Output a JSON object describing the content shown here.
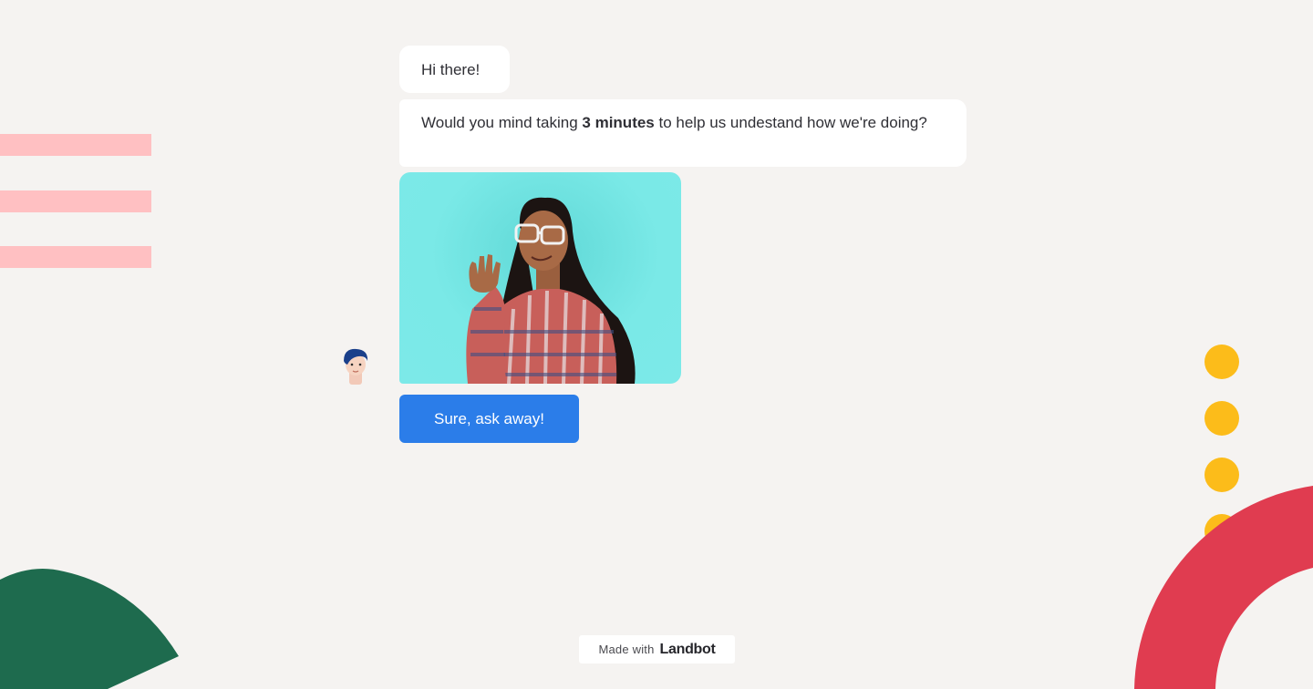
{
  "chat": {
    "messages": [
      {
        "text": "Hi there!"
      },
      {
        "before": "Would you mind taking ",
        "bold": "3 minutes",
        "after": " to help us undestand how we're doing?"
      }
    ],
    "reply_button": "Sure, ask away!"
  },
  "footer": {
    "made_with": "Made with",
    "brand": "Landbot"
  },
  "colors": {
    "background": "#f5f3f1",
    "button_blue": "#2b7de9",
    "stripe_pink": "#ffc0c2",
    "dot_yellow": "#fcbc1a",
    "shape_green": "#1e6b4e",
    "shape_red": "#e03c50",
    "photo_teal": "#7ae9e7"
  },
  "icons": {
    "avatar": "bot-avatar-icon",
    "photo": "woman-waving-photo"
  }
}
